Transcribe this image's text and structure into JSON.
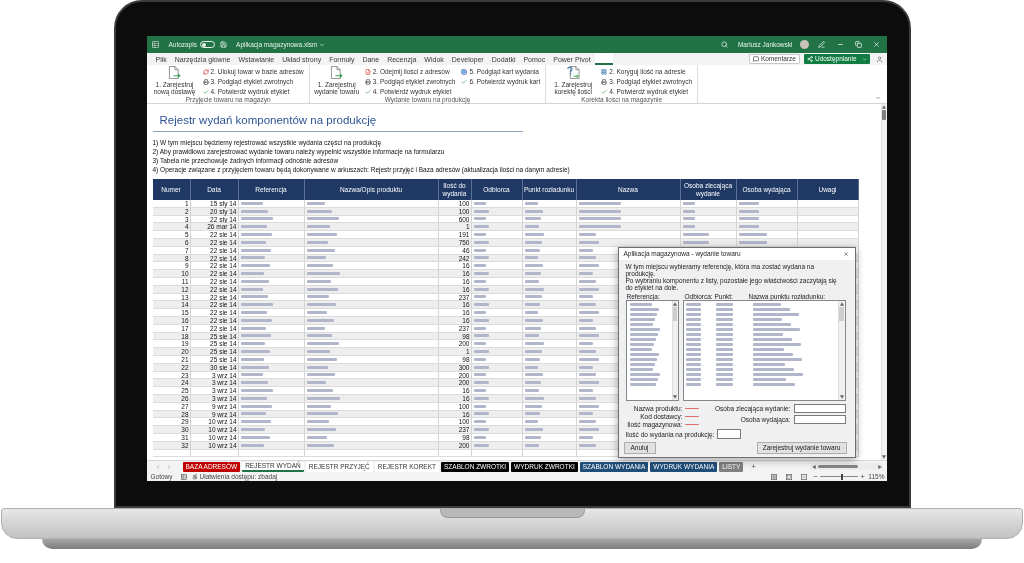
{
  "title_bar": {
    "autosave": {
      "label": "Autozapis",
      "on": false
    },
    "file_name": "Aplikacja magazynowa.xlsm",
    "user": "Mariusz Jankowski"
  },
  "ribbon_tabs": [
    {
      "label": "Plik",
      "selected": false
    },
    {
      "label": "Narzędzia główne",
      "selected": false
    },
    {
      "label": "Wstawianie",
      "selected": false
    },
    {
      "label": "Układ strony",
      "selected": false
    },
    {
      "label": "Formuły",
      "selected": false
    },
    {
      "label": "Dane",
      "selected": false
    },
    {
      "label": "Recenzja",
      "selected": false
    },
    {
      "label": "Widok",
      "selected": false
    },
    {
      "label": "Developer",
      "selected": false
    },
    {
      "label": "Dodatki",
      "selected": false
    },
    {
      "label": "Pomoc",
      "selected": false
    },
    {
      "label": "Power Pivot",
      "selected": false
    },
    {
      "selected": true
    }
  ],
  "header_buttons": {
    "comments": "Komentarze",
    "share": "Udostępnianie"
  },
  "ribbon_groups": [
    {
      "label": "Przyjęcie towaru na magazyn",
      "buttons": [
        {
          "label": "1. Zarejestruj nową dostawę",
          "kind": "large"
        },
        {
          "label": "2. Ulokuj towar w bazie adresów",
          "kind": "small"
        },
        {
          "label": "3. Podgląd etykiet zwrotnych",
          "kind": "small"
        },
        {
          "label": "4. Potwierdź wydruk etykiet",
          "kind": "small"
        }
      ]
    },
    {
      "label": "Wydanie towaru na produkcję",
      "buttons": [
        {
          "label": "1. Zarejestruj wydanie towaru",
          "kind": "large"
        },
        {
          "label": "2. Odejmij ilości z adresów",
          "kind": "small"
        },
        {
          "label": "3. Podgląd etykiet zwrotnych",
          "kind": "small"
        },
        {
          "label": "4. Potwierdź wydruk etykiet",
          "kind": "small"
        },
        {
          "label": "5. Podgląd kart wydania",
          "kind": "small"
        },
        {
          "label": "6. Potwierdź wydruk kart",
          "kind": "small"
        }
      ]
    },
    {
      "label": "Korekta ilości na magazynie",
      "buttons": [
        {
          "label": "1. Zarejestruj korektę ilości",
          "kind": "large"
        },
        {
          "label": "2. Koryguj ilość na adresie",
          "kind": "small"
        },
        {
          "label": "3. Podgląd etykiet zwrotnych",
          "kind": "small"
        },
        {
          "label": "4. Potwierdź wydruk etykiet",
          "kind": "small"
        }
      ]
    }
  ],
  "sheet": {
    "title": "Rejestr wydań komponentów na produkcję",
    "notes": [
      "1) W tym miejscu będziemy rejestrować wszystkie wydania części na produkcję",
      "2) Aby prawidłowo zarejestrować wydanie towaru należy wypełnić wszystkie informacje na formularzu",
      "3) Tabela nie przechowuje żadnych informacji odnośnie adresów",
      "4) Operacje związane z przyjęciem towaru będą dokonywane w arkuszach: Rejestr przyjęć i Baza adresów (aktualizacja ilości na danym adresie)"
    ],
    "table": {
      "columns": [
        {
          "label": "Numer",
          "kind": "number"
        },
        {
          "label": "Data",
          "kind": "date"
        },
        {
          "label": "Referencja",
          "kind": "blurred"
        },
        {
          "label": "Nazwa/Opis produktu",
          "kind": "blurred"
        },
        {
          "label": "Ilość do wydania",
          "kind": "quantity"
        },
        {
          "label": "Odbiorca",
          "kind": "blurred"
        },
        {
          "label": "Punkt rozładunku",
          "kind": "blurred"
        },
        {
          "label": "Nazwa",
          "kind": "blurred"
        },
        {
          "label": "Osoba zlecająca wydanie",
          "kind": "blurred"
        },
        {
          "label": "Osoba wydająca",
          "kind": "blurred"
        },
        {
          "label": "Uwagi",
          "kind": "empty"
        }
      ],
      "rows": [
        {
          "number": "1",
          "date": "15 sty 14",
          "quantity": "100"
        },
        {
          "number": "2",
          "date": "20 sty 14",
          "quantity": "100"
        },
        {
          "number": "3",
          "date": "22 sty 14",
          "quantity": "600"
        },
        {
          "number": "4",
          "date": "26 mar 14",
          "quantity": "1"
        },
        {
          "number": "5",
          "date": "22 sie 14",
          "quantity": "191"
        },
        {
          "number": "6",
          "date": "22 sie 14",
          "quantity": "750"
        },
        {
          "number": "7",
          "date": "22 sie 14",
          "quantity": "46"
        },
        {
          "number": "8",
          "date": "22 sie 14",
          "quantity": "242"
        },
        {
          "number": "9",
          "date": "22 sie 14",
          "quantity": "16"
        },
        {
          "number": "10",
          "date": "22 sie 14",
          "quantity": "16"
        },
        {
          "number": "11",
          "date": "22 sie 14",
          "quantity": "16"
        },
        {
          "number": "12",
          "date": "22 sie 14",
          "quantity": "16"
        },
        {
          "number": "13",
          "date": "22 sie 14",
          "quantity": "237"
        },
        {
          "number": "14",
          "date": "22 sie 14",
          "quantity": "16"
        },
        {
          "number": "15",
          "date": "22 sie 14",
          "quantity": "16"
        },
        {
          "number": "16",
          "date": "22 sie 14",
          "quantity": "16"
        },
        {
          "number": "17",
          "date": "22 sie 14",
          "quantity": "237"
        },
        {
          "number": "18",
          "date": "25 sie 14",
          "quantity": "98"
        },
        {
          "number": "19",
          "date": "25 sie 14",
          "quantity": "200"
        },
        {
          "number": "20",
          "date": "25 sie 14",
          "quantity": "1"
        },
        {
          "number": "21",
          "date": "25 sie 14",
          "quantity": "98"
        },
        {
          "number": "22",
          "date": "30 sie 14",
          "quantity": "300"
        },
        {
          "number": "23",
          "date": "3 wrz 14",
          "quantity": "200"
        },
        {
          "number": "24",
          "date": "3 wrz 14",
          "quantity": "200"
        },
        {
          "number": "25",
          "date": "3 wrz 14",
          "quantity": "16"
        },
        {
          "number": "26",
          "date": "3 wrz 14",
          "quantity": "16"
        },
        {
          "number": "27",
          "date": "9 wrz 14",
          "quantity": "100"
        },
        {
          "number": "28",
          "date": "9 wrz 14",
          "quantity": "16"
        },
        {
          "number": "29",
          "date": "10 wrz 14",
          "quantity": "100"
        },
        {
          "number": "30",
          "date": "10 wrz 14",
          "quantity": "237"
        },
        {
          "number": "31",
          "date": "10 wrz 14",
          "quantity": "98"
        },
        {
          "number": "32",
          "date": "10 wrz 14",
          "quantity": "200"
        }
      ]
    }
  },
  "dialog": {
    "title": "Aplikacja magazynowa - wydanie towaru",
    "intro": [
      "W tym miejscu wybieramy referencję, która ma zostać wydana na produkcję.",
      "Po wybraniu komponentu z listy, pozostałe jego właściwości zaczytają się do etykiet na dole."
    ],
    "list_labels": [
      "Referencja:",
      "Odbiorca:",
      "Punkt:",
      "Nazwa punktu rozładunku:"
    ],
    "info_labels": [
      "Nazwa produktu:",
      "Kod dostawcy:",
      "Ilość magazynowa:"
    ],
    "quantity_label": "Ilość do wydania na produkcję:",
    "person_labels": [
      "Osoba zlecająca wydanie:",
      "Osoba wydająca:"
    ],
    "cancel": "Anuluj",
    "submit": "Zarejestruj wydanie towaru"
  },
  "sheet_tabs": [
    {
      "label": "BAZA ADRESÓW",
      "selected": false,
      "color": "#c00000"
    },
    {
      "label": "REJESTR WYDAŃ",
      "selected": true
    },
    {
      "label": "REJESTR PRZYJĘĆ",
      "selected": false
    },
    {
      "label": "REJESTR KOREKT",
      "selected": false
    },
    {
      "label": "SZABLON ZWROTKI",
      "selected": false,
      "color": "#000000"
    },
    {
      "label": "WYDRUK ZWROTKI",
      "selected": false,
      "color": "#000000"
    },
    {
      "label": "SZABLON WYDANIA",
      "selected": false,
      "color": "#1f4e79"
    },
    {
      "label": "WYDRUK WYDANIA",
      "selected": false,
      "color": "#1f4e79"
    },
    {
      "label": "LISTY",
      "selected": false,
      "color": "#7f7f7f"
    }
  ],
  "add_sheet": "+",
  "status_bar": {
    "status": "Gotowy",
    "accessibility": "Ułatwienia dostępu: zbadaj",
    "zoom": {
      "level": 0.55,
      "reading": "115%"
    }
  }
}
